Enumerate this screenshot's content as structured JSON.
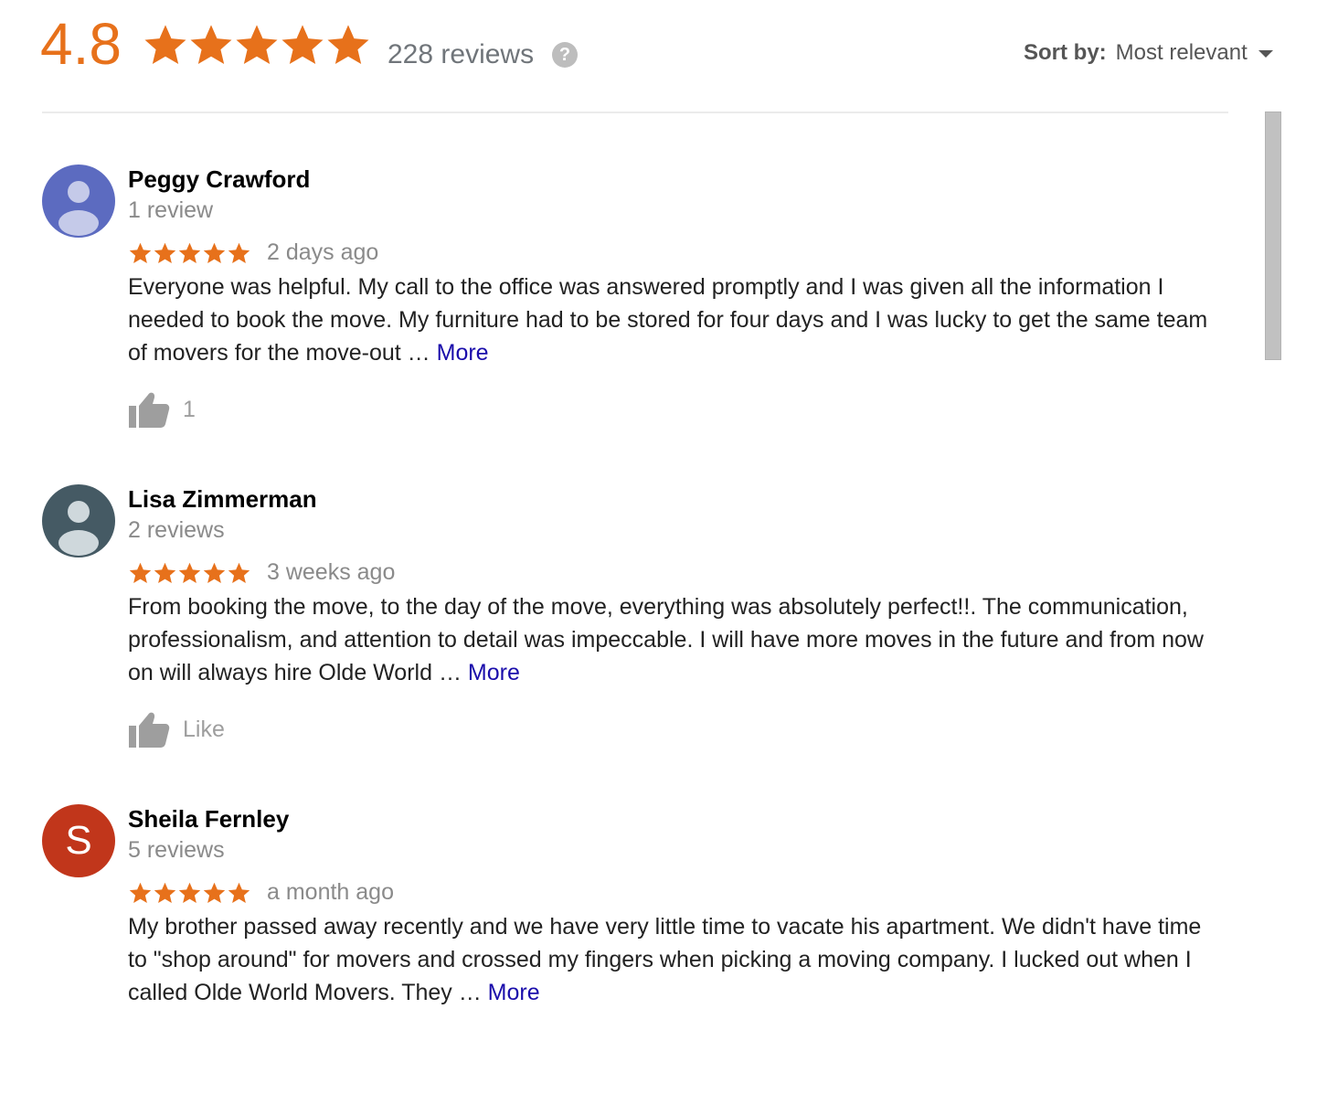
{
  "header": {
    "rating": "4.8",
    "review_count": "228 reviews",
    "help_symbol": "?",
    "sort_label": "Sort by:",
    "sort_value": "Most relevant"
  },
  "colors": {
    "star": "#e7711b",
    "link": "#1a0dab",
    "muted": "#8a8a8a"
  },
  "reviews": [
    {
      "name": "Peggy Crawford",
      "count": "1 review",
      "stars": 5,
      "date": "2 days ago",
      "text": "Everyone was helpful.  My call to the office was answered promptly and I was given all the information I needed to book the move.  My furniture had to be stored for four days and I was lucky to get the same team of movers for the move-out … ",
      "more": "More",
      "like": "1",
      "avatar": "person-icon",
      "avatar_color": "#5c6bc0"
    },
    {
      "name": "Lisa Zimmerman",
      "count": "2 reviews",
      "stars": 5,
      "date": "3 weeks ago",
      "text": "From booking the move, to the day of the move, everything was absolutely perfect!!. The communication, professionalism, and attention to detail was impeccable. I will have more moves in the future and from now on will always hire Olde World … ",
      "more": "More",
      "like": "Like",
      "avatar": "person-icon",
      "avatar_color": "#455a64"
    },
    {
      "name": "Sheila Fernley",
      "count": "5 reviews",
      "stars": 5,
      "date": "a month ago",
      "text": "My brother passed away recently and we have very little time to vacate his apartment. We didn't have time to \"shop around\" for movers and crossed my fingers when picking a moving company. I lucked out when I called Olde World Movers. They … ",
      "more": "More",
      "avatar_letter": "S",
      "avatar_color": "#c1361b"
    }
  ]
}
